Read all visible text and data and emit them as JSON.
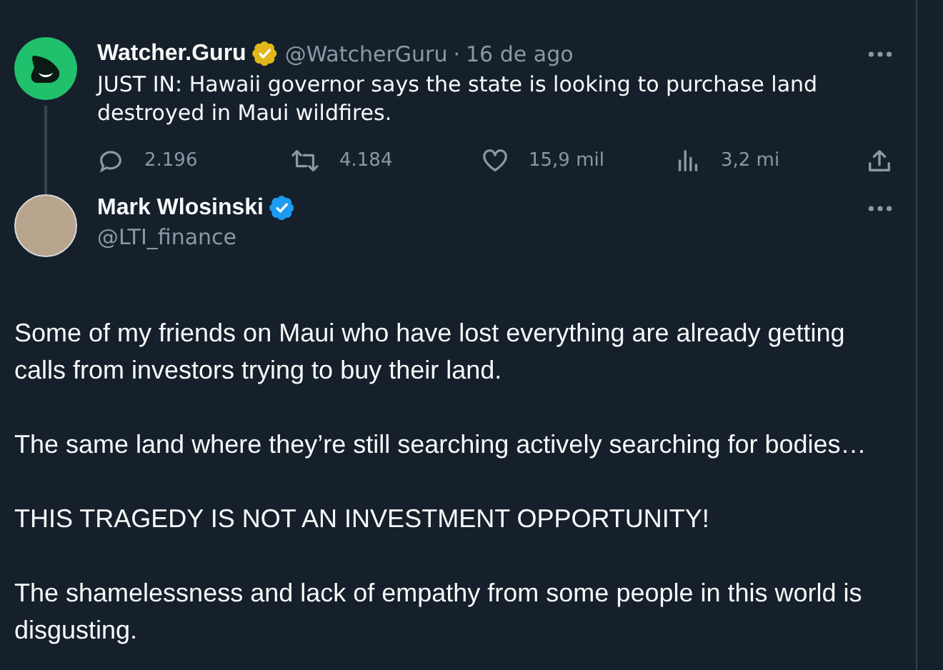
{
  "quoted_tweet": {
    "name": "Watcher.Guru",
    "handle": "@WatcherGuru",
    "separator": "·",
    "date": "16 de ago",
    "verified": true,
    "color": "#e2b719",
    "text": "JUST IN: Hawaii governor says the state is looking to purchase land destroyed in Maui wildfires.",
    "actions": [
      {
        "kind": "reply",
        "count": "2.196"
      },
      {
        "kind": "retweet",
        "count": "4.184"
      },
      {
        "kind": "like",
        "count": "15,9 mil"
      },
      {
        "kind": "views",
        "count": "3,2 mi"
      },
      {
        "kind": "share"
      }
    ]
  },
  "tweet": {
    "name": "Mark Wlosinski",
    "handle": "@LTI_finance",
    "verified": true,
    "color": "#1d9bf0",
    "paragraphs": [
      "Some of my friends on Maui who have lost everything are already getting calls from investors trying to buy their land.",
      "The same land where they’re still searching actively searching for bodies…",
      "THIS TRAGEDY IS NOT AN INVESTMENT OPPORTUNITY!",
      "The shamelessness and lack of empathy from some people in this world is disgusting."
    ]
  }
}
